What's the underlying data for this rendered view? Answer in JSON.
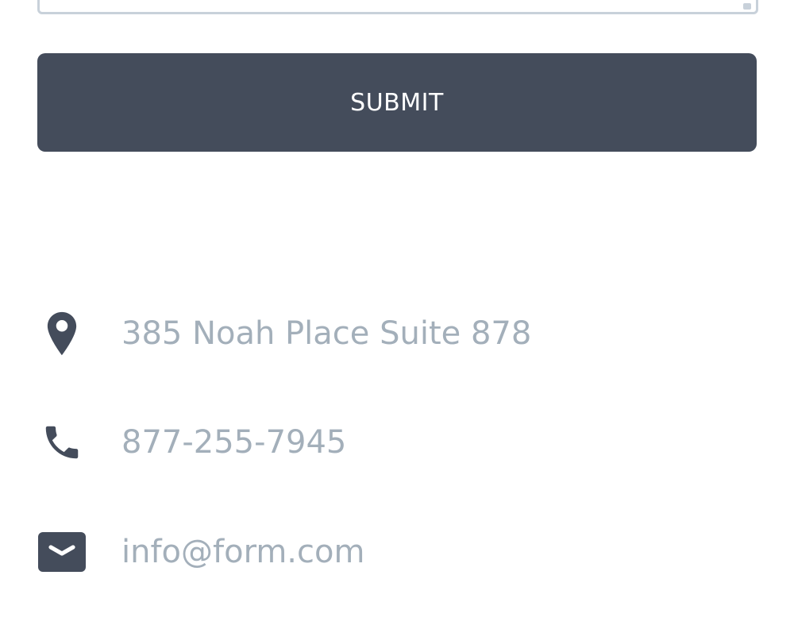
{
  "form": {
    "submit_label": "SUBMIT"
  },
  "contact": {
    "items": [
      {
        "icon": "location-pin-icon",
        "text": "385 Noah Place Suite 878"
      },
      {
        "icon": "phone-icon",
        "text": "877-255-7945"
      },
      {
        "icon": "mail-icon",
        "text": "info@form.com"
      }
    ]
  },
  "colors": {
    "button_bg": "#444c5b",
    "button_text": "#ffffff",
    "icon": "#444c5b",
    "contact_text": "#a3afba",
    "field_border": "#c8d1da"
  }
}
